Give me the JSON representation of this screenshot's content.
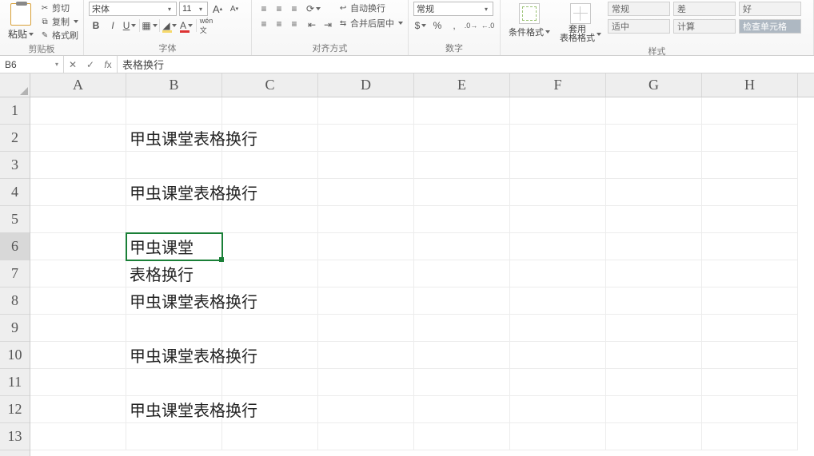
{
  "ribbon": {
    "clipboard": {
      "paste": "粘贴",
      "cut": "剪切",
      "copy": "复制",
      "brush": "格式刷",
      "label": "剪贴板"
    },
    "font": {
      "name": "宋体",
      "size": "11",
      "increase": "A",
      "decrease": "A",
      "label": "字体"
    },
    "align": {
      "wrap": "自动换行",
      "merge": "合并后居中",
      "label": "对齐方式"
    },
    "number": {
      "format": "常规",
      "label": "数字"
    },
    "styles": {
      "cond": "条件格式",
      "table": "套用\n表格格式",
      "c1": "常规",
      "c2": "差",
      "c3": "好",
      "c4": "适中",
      "c5": "计算",
      "c6": "检查单元格",
      "label": "样式"
    }
  },
  "namebox": "B6",
  "formula": "表格换行",
  "cols": [
    "A",
    "B",
    "C",
    "D",
    "E",
    "F",
    "G",
    "H"
  ],
  "rows": [
    "1",
    "2",
    "3",
    "4",
    "5",
    "6",
    "7",
    "8",
    "9",
    "10",
    "11",
    "12",
    "13"
  ],
  "active_row_index": 5,
  "cells": {
    "r2": "甲虫课堂表格换行",
    "r4": "甲虫课堂表格换行",
    "r6": "甲虫课堂",
    "r7": "表格换行",
    "r8": "甲虫课堂表格换行",
    "r10": "甲虫课堂表格换行",
    "r12": "甲虫课堂表格换行"
  }
}
